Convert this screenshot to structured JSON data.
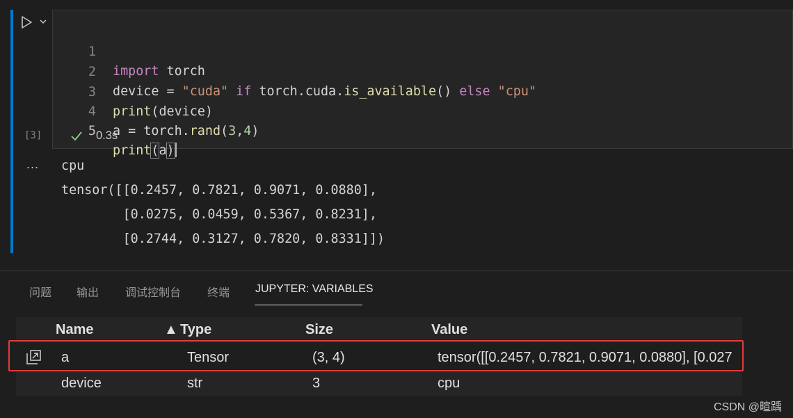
{
  "cell": {
    "lines": [
      {
        "num": "1"
      },
      {
        "num": "2"
      },
      {
        "num": "3"
      },
      {
        "num": "4"
      },
      {
        "num": "5"
      }
    ],
    "code": {
      "l1_kw": "import",
      "l1_rest": " torch",
      "l2_a": "device = ",
      "l2_s1": "\"cuda\"",
      "l2_if": " if ",
      "l2_b": "torch.cuda.",
      "l2_fn": "is_available",
      "l2_c": "() ",
      "l2_else": "else",
      "l2_sp": " ",
      "l2_s2": "\"cpu\"",
      "l3_fn": "print",
      "l3_rest": "(device)",
      "l4_a": "a = torch.",
      "l4_fn": "rand",
      "l4_b": "(",
      "l4_n1": "3",
      "l4_c": ",",
      "l4_n2": "4",
      "l4_d": ")",
      "l5_fn": "print",
      "l5_open": "(",
      "l5_arg": "a",
      "l5_close": ")"
    },
    "execution_count": "[3]",
    "status_icon": "check-icon",
    "exec_time": "0.3s"
  },
  "output": {
    "ellipsis": "...",
    "lines": [
      "cpu",
      "tensor([[0.2457, 0.7821, 0.9071, 0.0880],",
      "        [0.0275, 0.0459, 0.5367, 0.8231],",
      "        [0.2744, 0.3127, 0.7820, 0.8331]])"
    ]
  },
  "panel": {
    "tabs": [
      "问题",
      "输出",
      "调试控制台",
      "终端",
      "JUPYTER: VARIABLES"
    ],
    "active_tab": "JUPYTER: VARIABLES"
  },
  "variables": {
    "headers": {
      "name": "Name",
      "sort_indicator": "▲",
      "type": "Type",
      "size": "Size",
      "value": "Value"
    },
    "rows": [
      {
        "name": "a",
        "type": "Tensor",
        "size": "(3, 4)",
        "value": "tensor([[0.2457, 0.7821, 0.9071, 0.0880], [0.027"
      },
      {
        "name": "device",
        "type": "str",
        "size": "3",
        "value": "cpu"
      }
    ],
    "highlight_color": "#e03c3c"
  },
  "watermark": "CSDN @暄踽",
  "colors": {
    "accent": "#007acc",
    "check": "#89d185",
    "keyword": "#c586c0",
    "string": "#ce9178",
    "function": "#dcdcaa",
    "number": "#b5cea8"
  }
}
